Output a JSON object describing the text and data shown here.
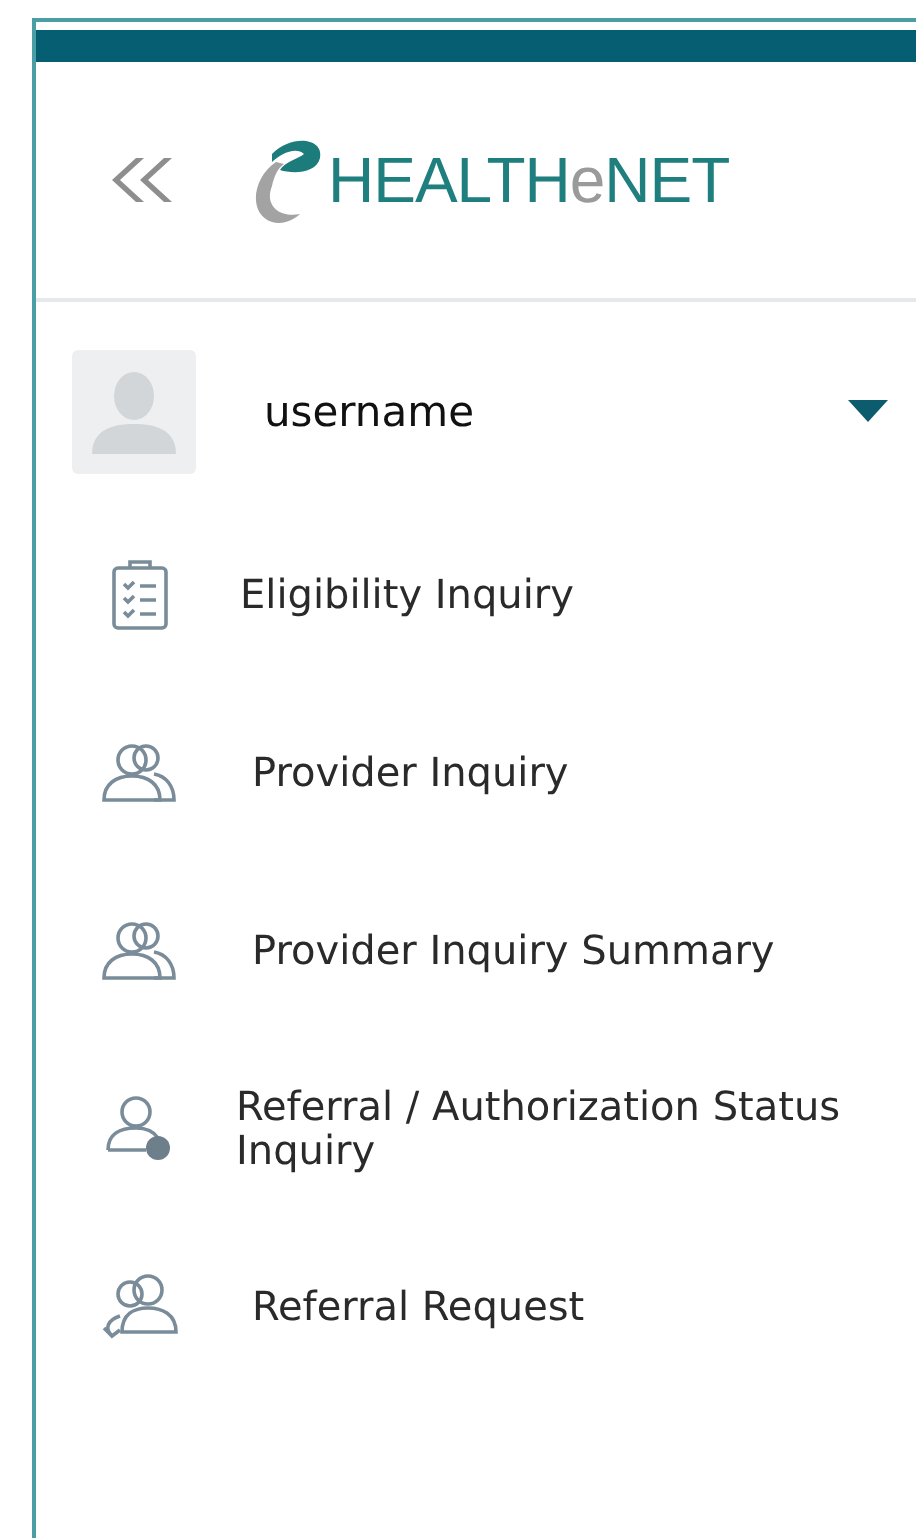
{
  "header": {
    "logo": {
      "prefix": "HEALTH",
      "accent": "e",
      "suffix": "NET"
    }
  },
  "user": {
    "name": "username"
  },
  "menu": [
    {
      "label": "Eligibility Inquiry",
      "kind": "clipboard"
    },
    {
      "label": "Provider Inquiry",
      "kind": "people"
    },
    {
      "label": "Provider Inquiry Summary",
      "kind": "people"
    },
    {
      "label": "Referral / Authorization Status Inquiry",
      "kind": "question"
    },
    {
      "label": "Referral Request",
      "kind": "referral"
    }
  ]
}
